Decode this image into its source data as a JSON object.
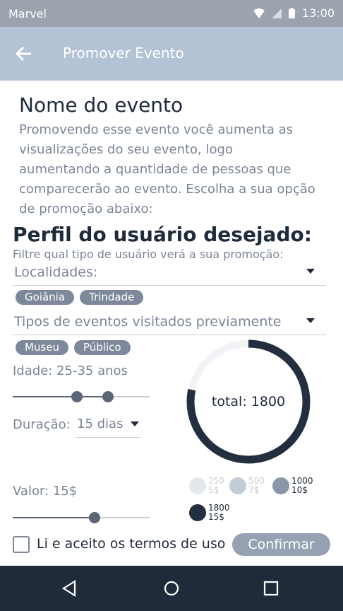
{
  "status_bar": {
    "carrier": "Marvel",
    "time": "13:00"
  },
  "app_bar": {
    "title": "Promover Evento",
    "back_icon": "arrow-left-icon"
  },
  "event": {
    "name": "Nome do evento",
    "description": "Promovendo esse evento você aumenta as visualizações do seu evento, logo aumentando a quantidade de pessoas que comparecerão ao evento. Escolha a sua opção de promoção abaixo:"
  },
  "profile": {
    "title": "Perfil do usuário desejado:",
    "hint": "Filtre qual tipo de usuário verá a sua promoção:",
    "locations": {
      "label": "Localidades:",
      "chips": [
        "Goiânia",
        "Trindade"
      ]
    },
    "event_types": {
      "label": "Tipos de eventos visitados previamente",
      "chips": [
        "Museu",
        "Público"
      ]
    },
    "age": {
      "label": "Idade: 25-35 anos",
      "min": 25,
      "max": 35
    },
    "duration": {
      "label": "Duração:",
      "value": "15 dias"
    },
    "price": {
      "label": "Valor: 15$",
      "level": 0.6
    }
  },
  "chart_data": {
    "type": "pie",
    "center_label": "total: 1800",
    "categories": [
      "250 5$",
      "500 7$",
      "1000 10$",
      "1800 15$"
    ],
    "values": [
      250,
      500,
      1000,
      1800
    ],
    "total_scale": 2300,
    "colors": [
      "#e3e8ef",
      "#c2ccd8",
      "#8b97a8",
      "#232f3e"
    ],
    "legend": [
      {
        "reach": "250",
        "price": "5$",
        "color": "#e3e8ef"
      },
      {
        "reach": "500",
        "price": "7$",
        "color": "#c2ccd8"
      },
      {
        "reach": "1000",
        "price": "10$",
        "color": "#8b97a8"
      },
      {
        "reach": "1800",
        "price": "15$",
        "color": "#232f3e"
      }
    ]
  },
  "footer": {
    "terms_label": "Li e aceito os termos de uso",
    "terms_checked": false,
    "confirm_label": "Confirmar"
  },
  "nav": {
    "back_icon": "triangle-back-icon",
    "home_icon": "circle-home-icon",
    "recents_icon": "square-recents-icon"
  }
}
